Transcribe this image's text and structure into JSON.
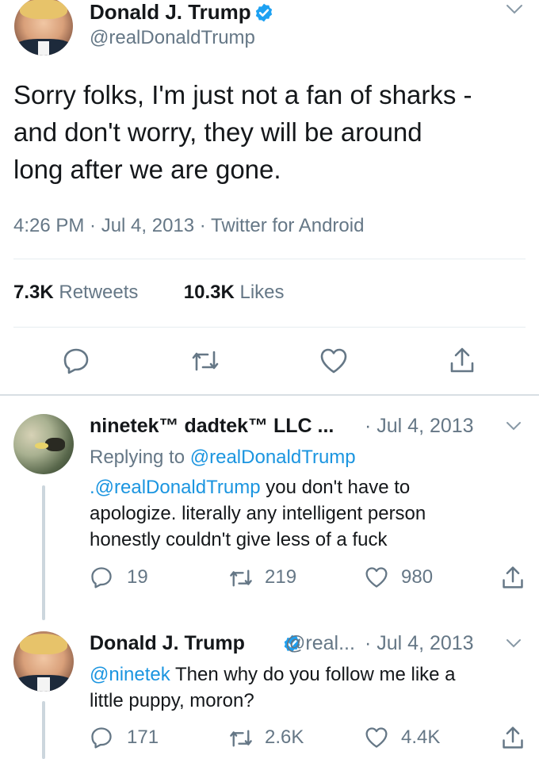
{
  "main_tweet": {
    "author_name": "Donald J. Trump",
    "author_handle": "@realDonaldTrump",
    "text": "Sorry folks, I'm just not a fan of sharks - and don't worry, they will be around long after we are gone.",
    "text_lines": [
      "Sorry folks, I'm just not a fan of sharks -",
      "and don't worry, they will be around",
      "long after we are gone."
    ],
    "meta": "4:26 PM · Jul 4, 2013 · Twitter for Android",
    "retweets_count": "7.3K",
    "retweets_label": "Retweets",
    "likes_count": "10.3K",
    "likes_label": "Likes"
  },
  "reply_1": {
    "author_name": "ninetek™ dadtek™ LLC ...",
    "date": "· Jul 4, 2013",
    "replying_prefix": "Replying to ",
    "replying_handle": "@realDonaldTrump",
    "mention": ".@realDonaldTrump",
    "text_after_mention": " you don't have to",
    "text_line2": "apologize. literally any intelligent person",
    "text_line3": "honestly couldn't give less of a fuck",
    "reply_count": "19",
    "retweet_count": "219",
    "like_count": "980"
  },
  "reply_2": {
    "author_name": "Donald J. Trump",
    "handle_truncated": "@real...",
    "date": "· Jul 4, 2013",
    "mention": "@ninetek",
    "text_after_mention": " Then why do you follow me like a",
    "text_line2": "little puppy, moron?",
    "reply_count": "171",
    "retweet_count": "2.6K",
    "like_count": "4.4K"
  },
  "colors": {
    "accent": "#1b95e0",
    "text": "#14171a",
    "secondary": "#657786",
    "divider": "#e6ecf0"
  },
  "icons": [
    "chevron-down-icon",
    "verified-badge-icon",
    "reply-icon",
    "retweet-icon",
    "like-icon",
    "share-icon"
  ]
}
